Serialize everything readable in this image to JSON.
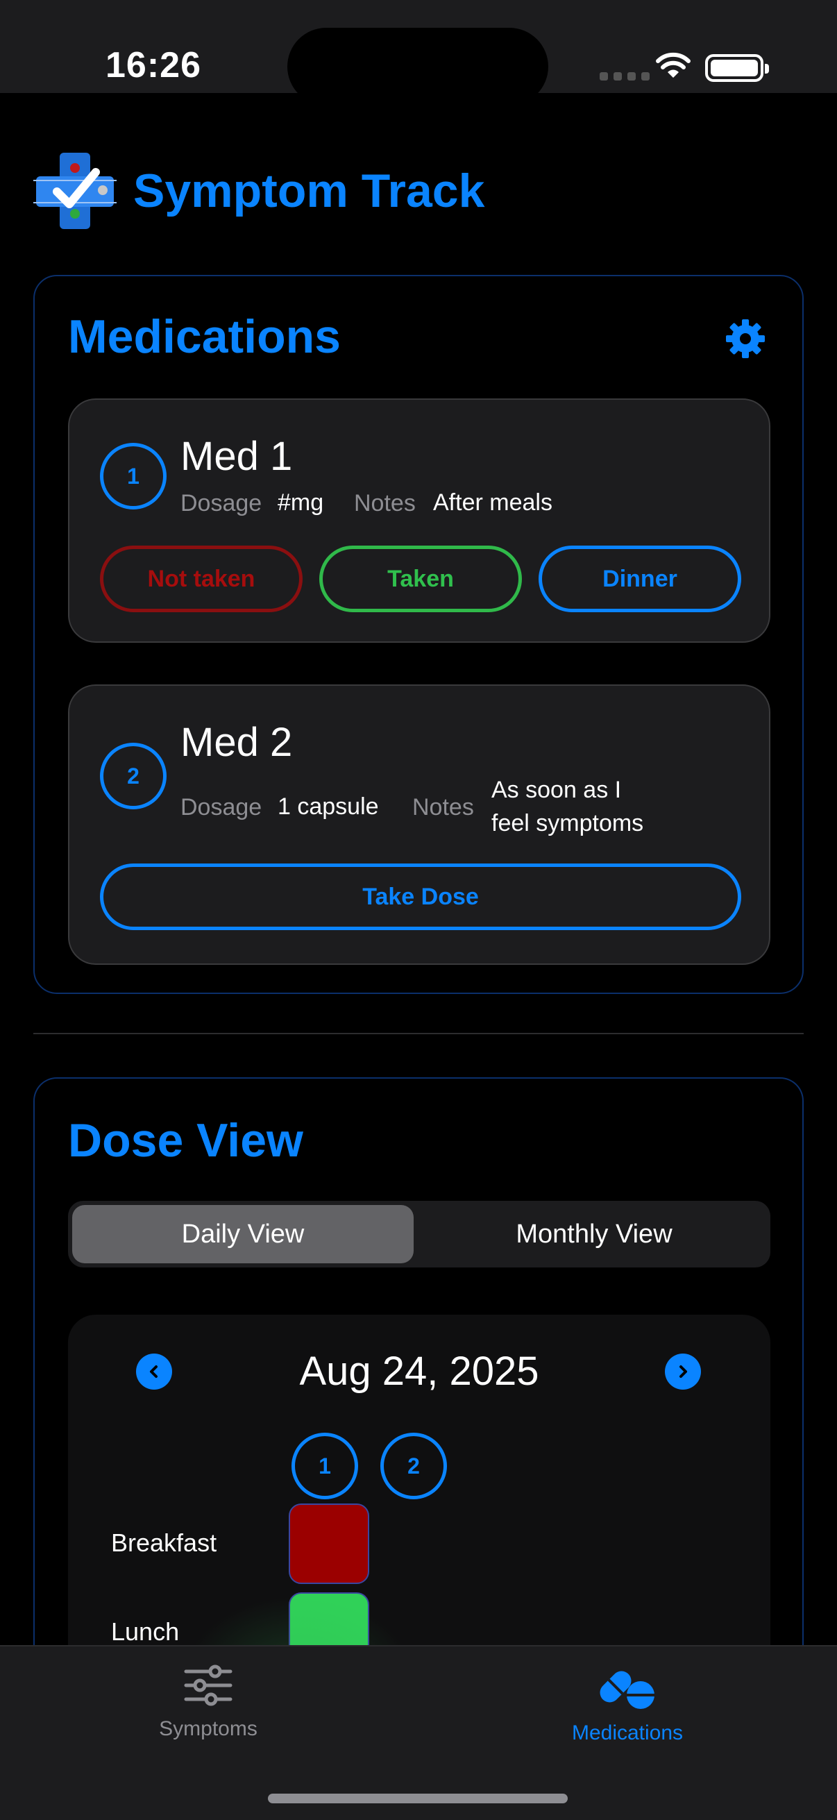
{
  "status_bar": {
    "time": "16:26"
  },
  "app": {
    "title": "Symptom Track"
  },
  "medications": {
    "title": "Medications",
    "items": [
      {
        "number": "1",
        "name": "Med 1",
        "dosage_label": "Dosage",
        "dosage": "#mg",
        "notes_label": "Notes",
        "notes": "After meals",
        "actions": {
          "not_taken": "Not taken",
          "taken": "Taken",
          "dinner": "Dinner"
        }
      },
      {
        "number": "2",
        "name": "Med 2",
        "dosage_label": "Dosage",
        "dosage": "1 capsule",
        "notes_label": "Notes",
        "notes_line1": "As soon as I",
        "notes_line2": "feel symptoms",
        "action": "Take Dose"
      }
    ]
  },
  "dose_view": {
    "title": "Dose View",
    "tabs": {
      "daily": "Daily View",
      "monthly": "Monthly View",
      "active": "daily"
    },
    "date": "Aug 24, 2025",
    "columns": [
      "1",
      "2"
    ],
    "rows": [
      {
        "label": "Breakfast",
        "status_color": "#9b0000"
      },
      {
        "label": "Lunch",
        "status_color": "#30d158"
      }
    ]
  },
  "tab_bar": {
    "items": [
      {
        "label": "Symptoms",
        "icon": "sliders-icon",
        "active": false
      },
      {
        "label": "Medications",
        "icon": "pills-icon",
        "active": true
      }
    ]
  },
  "colors": {
    "accent": "#0a84ff",
    "danger": "#a60d0d",
    "success": "#30c04d"
  }
}
